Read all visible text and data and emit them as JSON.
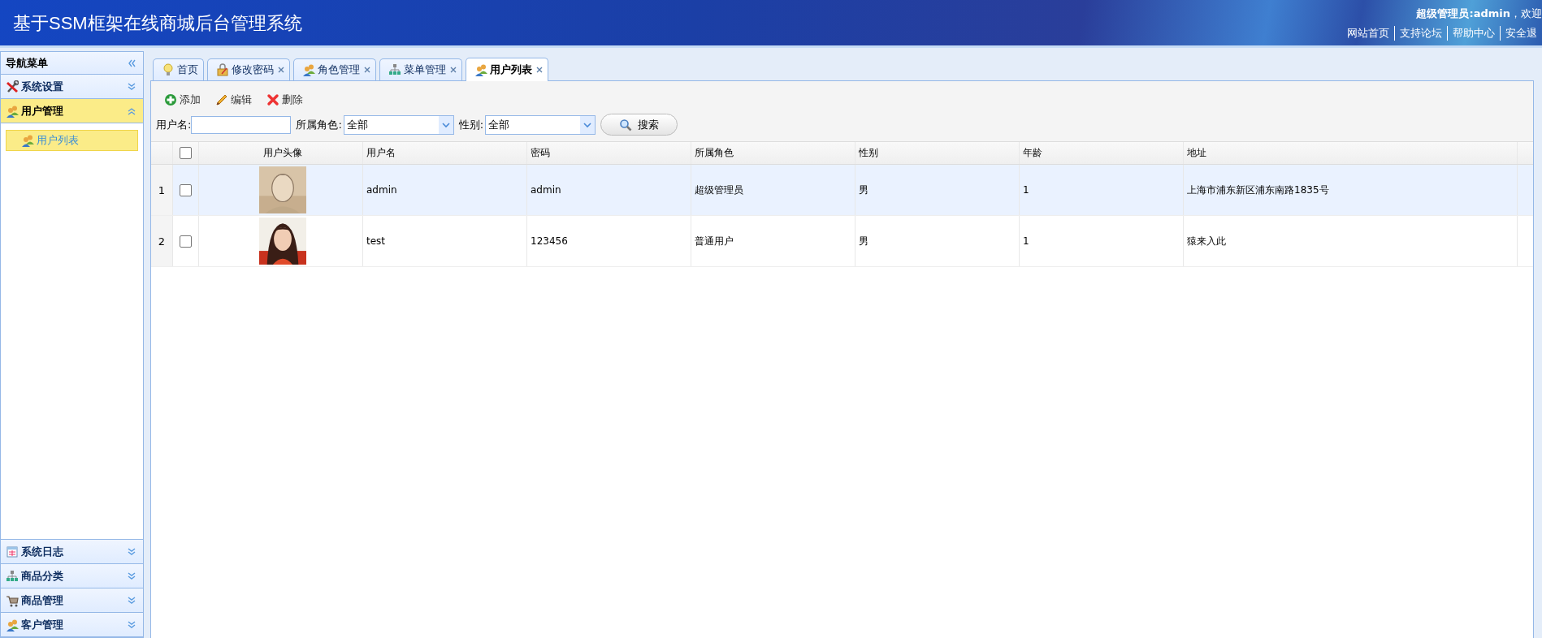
{
  "header": {
    "title": "基于SSM框架在线商城后台管理系统",
    "user": "超级管理员:admin",
    "welcome": "，欢迎",
    "links": [
      "网站首页",
      "支持论坛",
      "帮助中心",
      "安全退"
    ]
  },
  "sidebar": {
    "title": "导航菜单",
    "panels": [
      {
        "label": "系统设置",
        "expanded": false
      },
      {
        "label": "用户管理",
        "expanded": true,
        "children": [
          {
            "label": "用户列表",
            "selected": true
          }
        ]
      },
      {
        "label": "系统日志",
        "expanded": false
      },
      {
        "label": "商品分类",
        "expanded": false
      },
      {
        "label": "商品管理",
        "expanded": false
      },
      {
        "label": "客户管理",
        "expanded": false
      }
    ]
  },
  "tabs": [
    {
      "label": "首页",
      "closable": false,
      "selected": false
    },
    {
      "label": "修改密码",
      "closable": true,
      "selected": false
    },
    {
      "label": "角色管理",
      "closable": true,
      "selected": false
    },
    {
      "label": "菜单管理",
      "closable": true,
      "selected": false
    },
    {
      "label": "用户列表",
      "closable": true,
      "selected": true
    }
  ],
  "toolbar": [
    {
      "label": "添加"
    },
    {
      "label": "编辑"
    },
    {
      "label": "删除"
    }
  ],
  "filters": {
    "username": {
      "label": "用户名:"
    },
    "role": {
      "label": "所属角色:",
      "value": "全部"
    },
    "gender": {
      "label": "性别:",
      "value": "全部"
    },
    "search": "搜索"
  },
  "table": {
    "header_checked": false,
    "columns": {
      "avatar": "用户头像",
      "username": "用户名",
      "password": "密码",
      "role": "所属角色",
      "gender": "性别",
      "age": "年龄",
      "address": "地址"
    },
    "rows": [
      {
        "number": "1",
        "checked": false,
        "selected": true,
        "username": "admin",
        "password": "admin",
        "role": "超级管理员",
        "gender": "男",
        "age": "1",
        "address": "上海市浦东新区浦东南路1835号"
      },
      {
        "number": "2",
        "checked": false,
        "selected": false,
        "username": "test",
        "password": "123456",
        "role": "普通用户",
        "gender": "男",
        "age": "1",
        "address": "猿来入此"
      }
    ]
  }
}
